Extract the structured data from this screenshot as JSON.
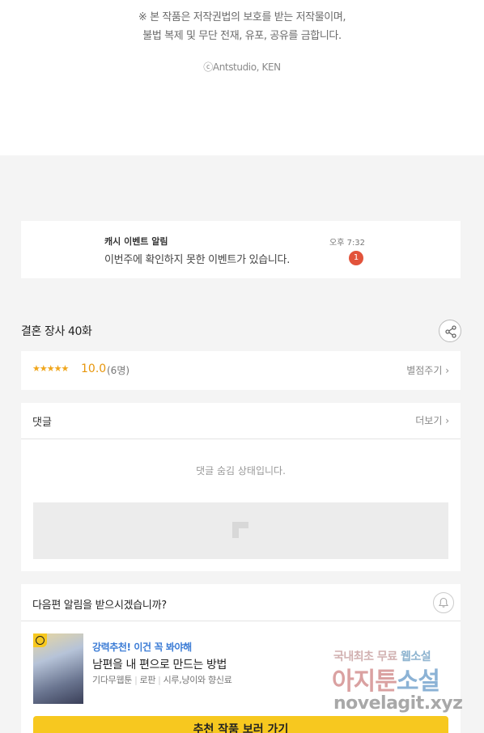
{
  "copyright": {
    "line1": "※ 본 작품은 저작권법의 보호를 받는 저작물이며,",
    "line2": "불법 복제 및 무단 전재, 유포, 공유를 금합니다.",
    "credit": "ⓒAntstudio, KEN"
  },
  "alarm": {
    "title": "캐시 이벤트 알림",
    "message": "이번주에 확인하지 못한 이벤트가 있습니다.",
    "time": "오후 7:32",
    "badge": "1"
  },
  "episode": {
    "title": "결혼 장사 40화",
    "share_icon": "share-icon"
  },
  "rating": {
    "stars": "★★★★★",
    "score": "10.0",
    "count": "(6명)",
    "rate_label": "별점주기 ›"
  },
  "comments": {
    "title": "댓글",
    "more_label": "더보기 ›",
    "hidden_message": "댓글 숨김 상태입니다."
  },
  "next_episode": {
    "question": "다음편 알림을 받으시겠습니까?",
    "bell_icon": "bell-icon"
  },
  "recommendation": {
    "tag": "강력추천! 이건 꼭 봐야해",
    "title": "남편을 내 편으로 만드는 방법",
    "meta": [
      "기다무웹툰",
      "로판",
      "시루,냥이와 향신료"
    ],
    "cta_label": "추천 작품 보러 가기"
  },
  "watermark": {
    "line1_a": "국내최초 무료",
    "line1_b": "웹소설",
    "line2_a": "아지툰",
    "line2_b": "소설",
    "line3": "novelagit.xyz"
  },
  "colors": {
    "accent_yellow": "#f7c81f",
    "badge_red": "#e2533b",
    "score_orange": "#e7960c",
    "tag_blue": "#3a7bd5"
  }
}
